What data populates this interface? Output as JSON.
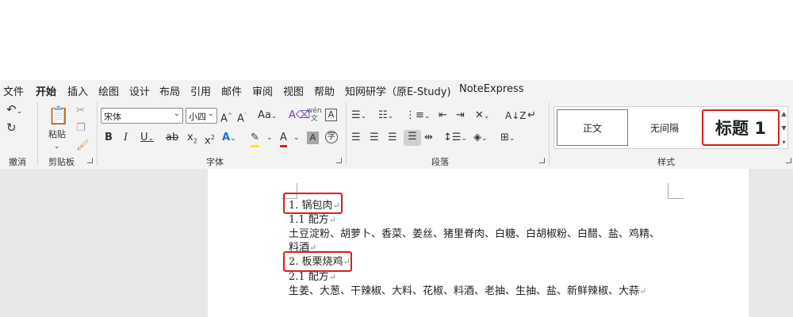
{
  "menu": [
    "文件",
    "开始",
    "插入",
    "绘图",
    "设计",
    "布局",
    "引用",
    "邮件",
    "审阅",
    "视图",
    "帮助",
    "知网研学（原E-Study)",
    "NoteExpress"
  ],
  "ribbon": {
    "groups": {
      "undo": "撤消",
      "clipboard": "剪贴板",
      "font": "字体",
      "paragraph": "段落",
      "styles": "样式"
    },
    "paste_label": "粘贴",
    "font_name": "宋体",
    "font_size": "小四",
    "styles": [
      "正文",
      "无间隔",
      "标题 1"
    ]
  },
  "document": {
    "lines": [
      "1. 锅包肉",
      "1.1 配方",
      "土豆淀粉、胡萝卜、香菜、姜丝、猪里脊肉、白糖、白胡椒粉、白醋、盐、鸡精、",
      "料酒",
      "2. 板栗烧鸡",
      "2.1 配方",
      "生姜、大葱、干辣椒、大料、花椒、料酒、老抽、生抽、盐、新鲜辣椒、大蒜"
    ],
    "paragraph_mark": "↵"
  },
  "colors": {
    "highlight_border": "#d9201c",
    "accent": "#185abd",
    "ribbon_bg": "#f3f3f3"
  }
}
